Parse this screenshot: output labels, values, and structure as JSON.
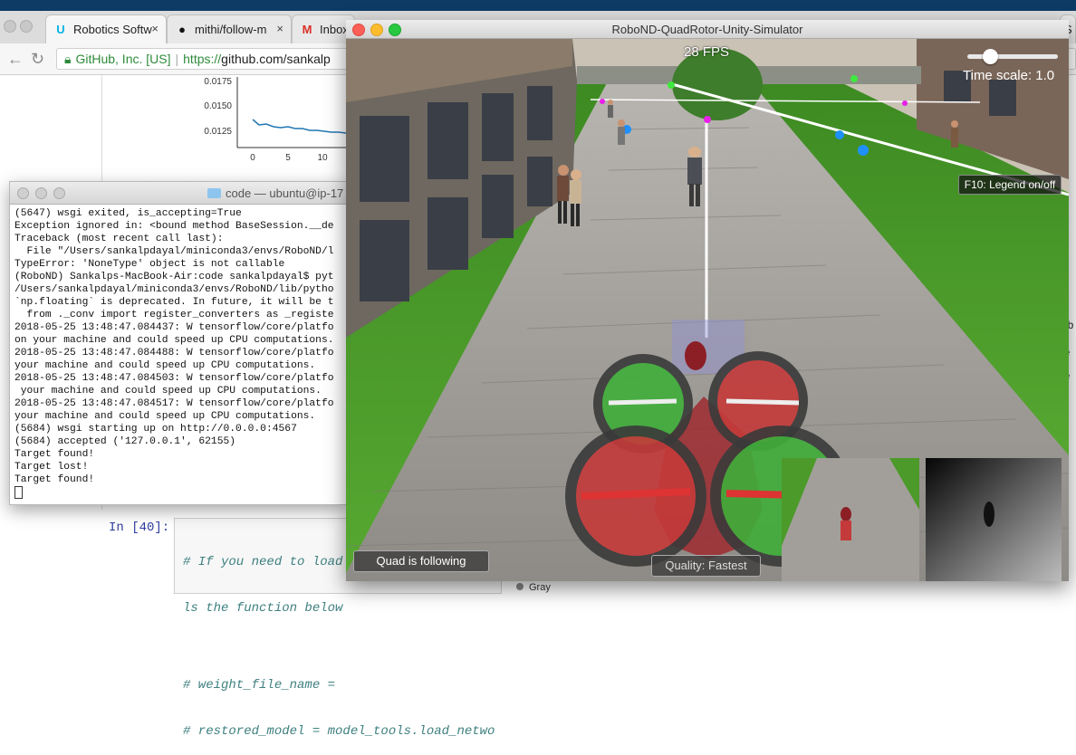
{
  "browser": {
    "tabs": [
      {
        "label": "Robotics Softw",
        "icon": "udacity-icon",
        "close": "×"
      },
      {
        "label": "mithi/follow-m",
        "icon": "github-icon",
        "close": "×"
      },
      {
        "label": "Inbox",
        "icon": "gmail-icon",
        "close": ""
      }
    ],
    "right_tab": "S",
    "address": {
      "security_label": "GitHub, Inc. [US]",
      "scheme": "https://",
      "path": "github.com/sankalp"
    },
    "back_glyph": "←",
    "reload_glyph": "↻"
  },
  "notebook": {
    "chart_ticks_y": [
      "0.0175",
      "0.0150",
      "0.0125"
    ],
    "chart_ticks_x": [
      "0",
      "5",
      "10"
    ],
    "prompt": "In [40]:",
    "code_lines": [
      "# If you need to load",
      "ls the function below",
      "",
      "# weight_file_name =",
      "# restored_model = model_tools.load_netwo"
    ],
    "right_fragments": [
      "ab",
      "le",
      "le",
      "e",
      "3",
      "ir"
    ],
    "gray_label": "Gray"
  },
  "terminal": {
    "title": "code — ubuntu@ip-17",
    "lines": [
      "(5647) wsgi exited, is_accepting=True",
      "Exception ignored in: <bound method BaseSession.__de",
      "Traceback (most recent call last):",
      "  File \"/Users/sankalpdayal/miniconda3/envs/RoboND/l",
      "TypeError: 'NoneType' object is not callable",
      "(RoboND) Sankalps-MacBook-Air:code sankalpdayal$ pyt",
      "/Users/sankalpdayal/miniconda3/envs/RoboND/lib/pytho",
      "`np.floating` is deprecated. In future, it will be t",
      "  from ._conv import register_converters as _registe",
      "2018-05-25 13:48:47.084437: W tensorflow/core/platfo",
      "on your machine and could speed up CPU computations.",
      "2018-05-25 13:48:47.084488: W tensorflow/core/platfo",
      "your machine and could speed up CPU computations.",
      "2018-05-25 13:48:47.084503: W tensorflow/core/platfo",
      " your machine and could speed up CPU computations.",
      "2018-05-25 13:48:47.084517: W tensorflow/core/platfo",
      "your machine and could speed up CPU computations.",
      "(5684) wsgi starting up on http://0.0.0.0:4567",
      "(5684) accepted ('127.0.0.1', 62155)",
      "Target found!",
      "Target lost!",
      "Target found!"
    ]
  },
  "simulator": {
    "title": "RoboND-QuadRotor-Unity-Simulator",
    "fps": "28 FPS",
    "time_scale_label": "Time scale: 1.0",
    "time_scale_value": 1.0,
    "legend_hint": "F10: Legend on/off",
    "follow_status": "Quad is following",
    "quality": "Quality: Fastest",
    "colors": {
      "grass": "#4c9a2a",
      "path": "#9d9b97",
      "rotor_green": "#3fae3a",
      "rotor_red": "#c43a3a",
      "marker_magenta": "#e81fe8",
      "marker_blue": "#1e90ff"
    }
  }
}
